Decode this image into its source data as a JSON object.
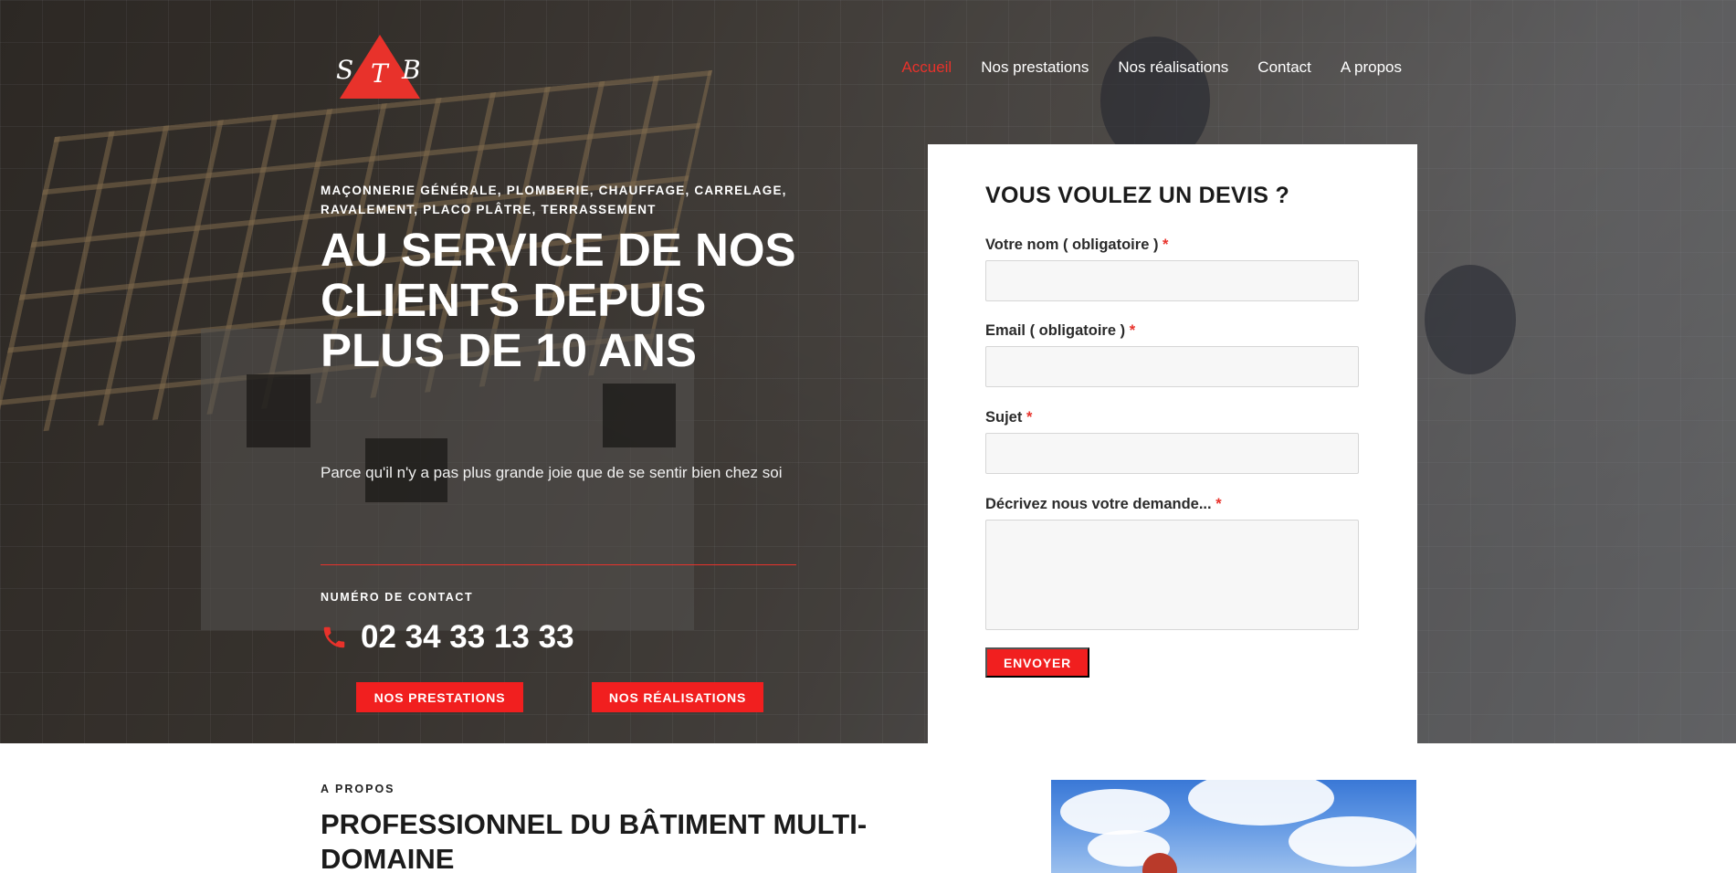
{
  "header": {
    "logo_letters": [
      "S",
      "T",
      "B"
    ],
    "nav": [
      {
        "label": "Accueil",
        "active": true
      },
      {
        "label": "Nos prestations",
        "active": false
      },
      {
        "label": "Nos réalisations",
        "active": false
      },
      {
        "label": "Contact",
        "active": false
      },
      {
        "label": "A propos",
        "active": false
      }
    ]
  },
  "hero": {
    "eyebrow": "Maçonnerie générale, plomberie, chauffage, carrelage, ravalement, placo plâtre, terrassement",
    "headline": "AU SERVICE DE NOS CLIENTS DEPUIS PLUS DE 10 ANS",
    "subtext": "Parce qu'il n'y a pas plus grande joie que de se sentir bien chez soi",
    "contact_label": "Numéro de contact",
    "phone": "02 34 33 13 33",
    "buttons": {
      "prestations": "Nos prestations",
      "realisations": "Nos réalisations"
    }
  },
  "quote_form": {
    "title": "VOUS VOULEZ UN DEVIS ?",
    "fields": [
      {
        "label": "Votre nom ( obligatoire )",
        "required_mark": "*",
        "value": "",
        "type": "text"
      },
      {
        "label": "Email ( obligatoire )",
        "required_mark": "*",
        "value": "",
        "type": "email"
      },
      {
        "label": "Sujet",
        "required_mark": "*",
        "value": "",
        "type": "text"
      },
      {
        "label": "Décrivez nous votre demande...",
        "required_mark": "*",
        "value": "",
        "type": "textarea"
      }
    ],
    "submit": "Envoyer"
  },
  "about": {
    "eyebrow": "A propos",
    "title": "PROFESSIONNEL DU BÂTIMENT MULTI-DOMAINE"
  },
  "colors": {
    "accent": "#e8322b",
    "button": "#f11f1f",
    "text_dark": "#1b1b1b",
    "white": "#ffffff"
  }
}
